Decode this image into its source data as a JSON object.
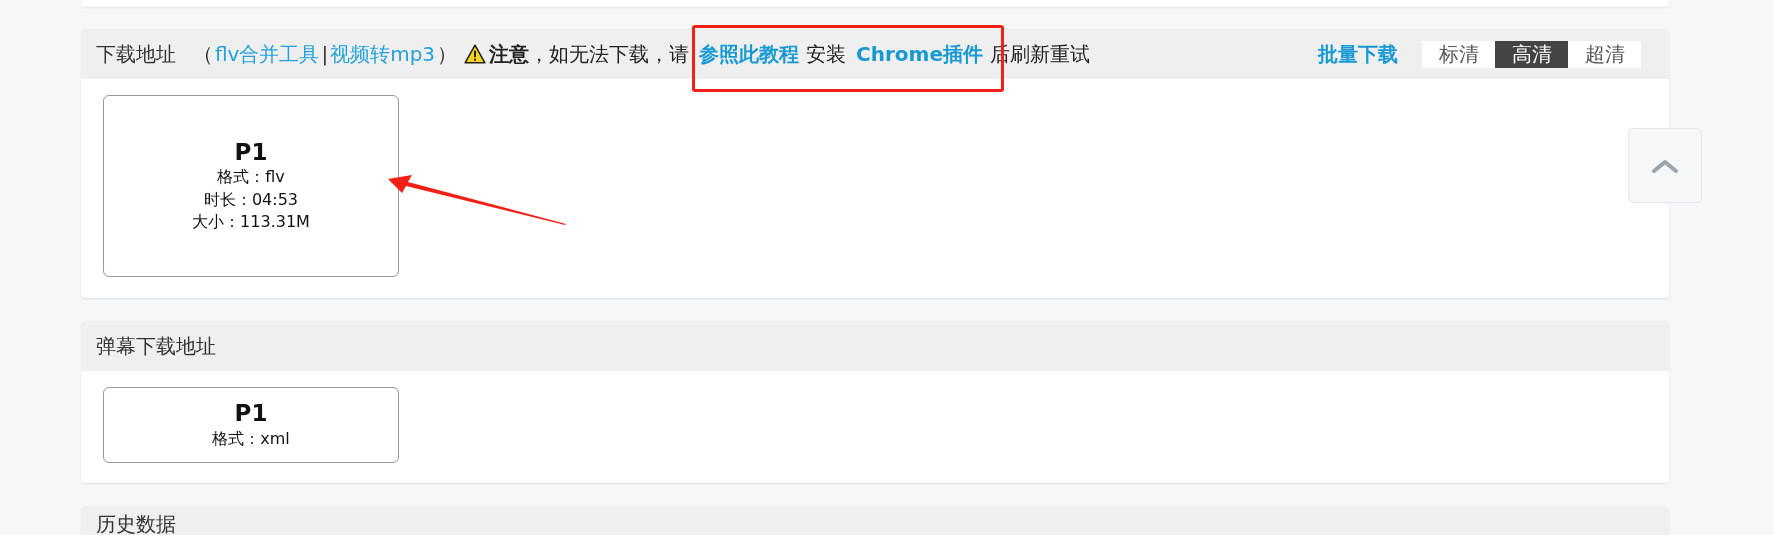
{
  "sections": [
    {
      "title": "下载地址",
      "tools": [
        {
          "kind": "text",
          "text": "（"
        },
        {
          "kind": "link",
          "text": "flv合并工具"
        },
        {
          "kind": "text",
          "text": "|"
        },
        {
          "kind": "link",
          "text": "视频转mp3"
        },
        {
          "kind": "text",
          "text": "）"
        }
      ],
      "notice": [
        {
          "kind": "text",
          "text": "**注意**，如无法下载，请"
        },
        {
          "kind": "link",
          "text": "参照此教程"
        },
        {
          "kind": "text",
          "text": "安装"
        },
        {
          "kind": "link",
          "text": "Chrome插件"
        },
        {
          "kind": "text",
          "text": "后刷新重试"
        }
      ],
      "batch": "批量下载",
      "quality": [
        {
          "label": "标清",
          "selected": false
        },
        {
          "label": "高清",
          "selected": true
        },
        {
          "label": "超清",
          "selected": false
        }
      ],
      "cards": [
        {
          "title": "P1",
          "lines": [
            "格式：flv",
            "时长：04:53",
            "大小：113.31M"
          ]
        }
      ]
    },
    {
      "title": "弹幕下载地址",
      "cards": [
        {
          "title": "P1",
          "lines": [
            "格式：xml"
          ]
        }
      ]
    },
    {
      "title": "历史数据"
    }
  ]
}
